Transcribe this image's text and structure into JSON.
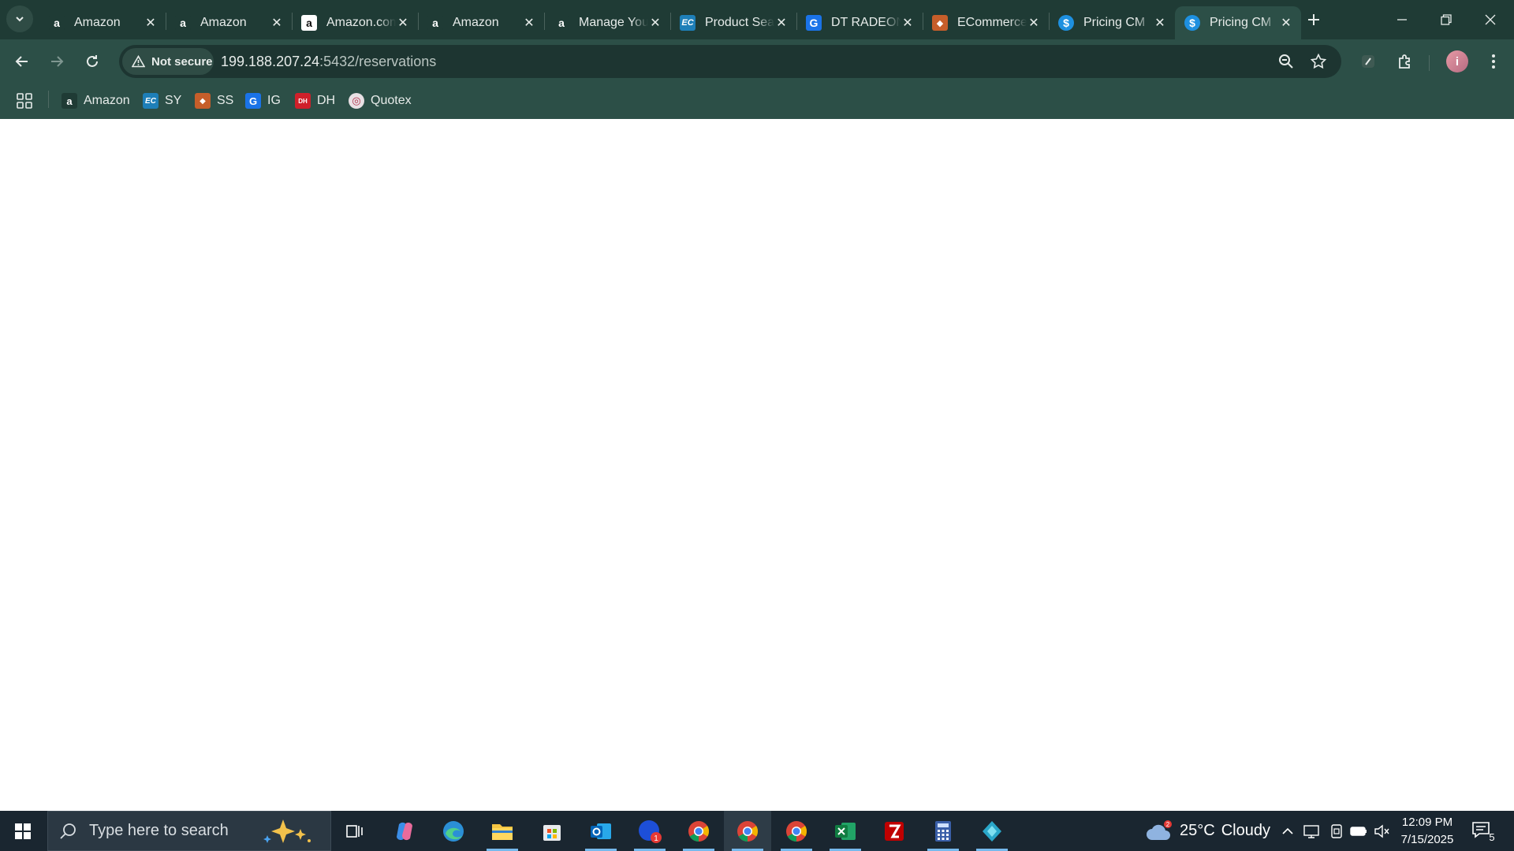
{
  "browser": {
    "tabs": [
      {
        "title": "Amazon",
        "favicon": "amazon-icon",
        "active": false
      },
      {
        "title": "Amazon",
        "favicon": "amazon-icon",
        "active": false
      },
      {
        "title": "Amazon.com",
        "favicon": "amazon-boxed-icon",
        "active": false
      },
      {
        "title": "Amazon",
        "favicon": "amazon-icon",
        "active": false
      },
      {
        "title": "Manage Your",
        "favicon": "amazon-icon",
        "active": false
      },
      {
        "title": "Product Search",
        "favicon": "ec-icon",
        "active": false
      },
      {
        "title": "DT RADEON",
        "favicon": "g-icon",
        "active": false
      },
      {
        "title": "ECommerce",
        "favicon": "ecommerce-icon",
        "active": false
      },
      {
        "title": "Pricing CM",
        "favicon": "dollar-icon",
        "active": false
      },
      {
        "title": "Pricing CM",
        "favicon": "dollar-icon",
        "active": true
      }
    ],
    "security_label": "Not secure",
    "url_host": "199.188.207.24",
    "url_rest": ":5432/reservations",
    "bookmarks": [
      {
        "label": "Amazon",
        "icon": "amazon-icon"
      },
      {
        "label": "SY",
        "icon": "ec-icon"
      },
      {
        "label": "SS",
        "icon": "ecommerce-icon"
      },
      {
        "label": "IG",
        "icon": "g-icon"
      },
      {
        "label": "DH",
        "icon": "dh-icon"
      },
      {
        "label": "Quotex",
        "icon": "quotex-icon"
      }
    ],
    "profile_initial": "i"
  },
  "taskbar": {
    "search_placeholder": "Type here to search",
    "weather_temp": "25°C",
    "weather_desc": "Cloudy",
    "weather_badge": "2",
    "time": "12:09 PM",
    "date": "7/15/2025",
    "notification_count": "5",
    "mail_badge": "1"
  },
  "colors": {
    "tab_strip": "#1f3b35",
    "toolbar": "#2c4f47",
    "taskbar": "#1a2630"
  }
}
